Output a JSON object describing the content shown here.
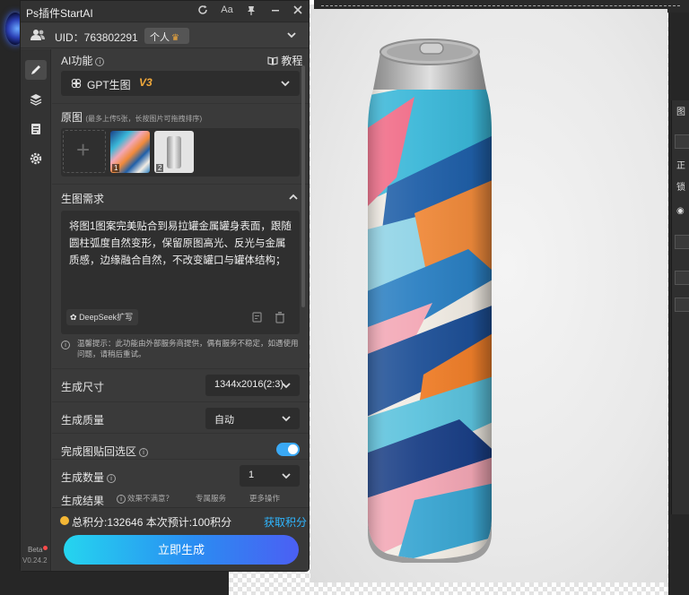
{
  "plugin": {
    "title": "Ps插件StartAI",
    "title_icons": [
      "refresh-icon",
      "font-size-icon",
      "pin-icon",
      "minimize-icon",
      "close-icon"
    ],
    "title_glyphs": {
      "font": "Aa"
    },
    "uid": "UID：763802291",
    "account_badge": "个人",
    "version": {
      "beta": "Beta",
      "number": "V0.24.2"
    }
  },
  "rail": {
    "items": [
      {
        "name": "edit-icon",
        "active": true
      },
      {
        "name": "layers-icon",
        "active": false
      },
      {
        "name": "document-icon",
        "active": false
      },
      {
        "name": "settings-icon",
        "active": false
      }
    ]
  },
  "ai_function": {
    "label": "AI功能",
    "tutorial": "教程",
    "model_name": "GPT生图",
    "model_version": "V3"
  },
  "source_images": {
    "label": "原图",
    "hint": "(最多上传5张，长按图片可拖拽排序)",
    "thumbnails": [
      {
        "index": "1",
        "content": "abstract-paint-pattern"
      },
      {
        "index": "2",
        "content": "metal-can"
      }
    ]
  },
  "prompt": {
    "label": "生图需求",
    "text": "将图1图案完美贴合到易拉罐金属罐身表面，跟随圆柱弧度自然变形，保留原图高光、反光与金属质感，边缘融合自然，不改变罐口与罐体结构；",
    "deepseek_label": "DeepSeek扩写",
    "notice": "温馨提示：此功能由外部服务商提供，偶有服务不稳定，如遇使用问题，请稍后重试。"
  },
  "options": {
    "size_label": "生成尺寸",
    "size_value": "1344x2016(2:3)",
    "quality_label": "生成质量",
    "quality_value": "自动",
    "paste_back_label": "完成图贴回选区",
    "paste_back_on": true,
    "count_label": "生成数量",
    "count_value": "1",
    "result_label": "生成结果",
    "result_partial_1": "效果不满意？",
    "result_partial_2": "专属服务",
    "result_partial_3": "更多操作"
  },
  "footer": {
    "points_text": "总积分:132646  本次预计:100积分",
    "get_points": "获取积分",
    "generate": "立即生成"
  },
  "ps_panel": {
    "labels": [
      "图",
      "正",
      "锁"
    ]
  },
  "colors": {
    "accent": "#2fb6ff",
    "gen_gradient_start": "#25d5ef",
    "gen_gradient_end": "#4b5ff3",
    "version_tag": "#f2a93b",
    "coin": "#f4b735",
    "toggle_on": "#3aa9f5"
  }
}
